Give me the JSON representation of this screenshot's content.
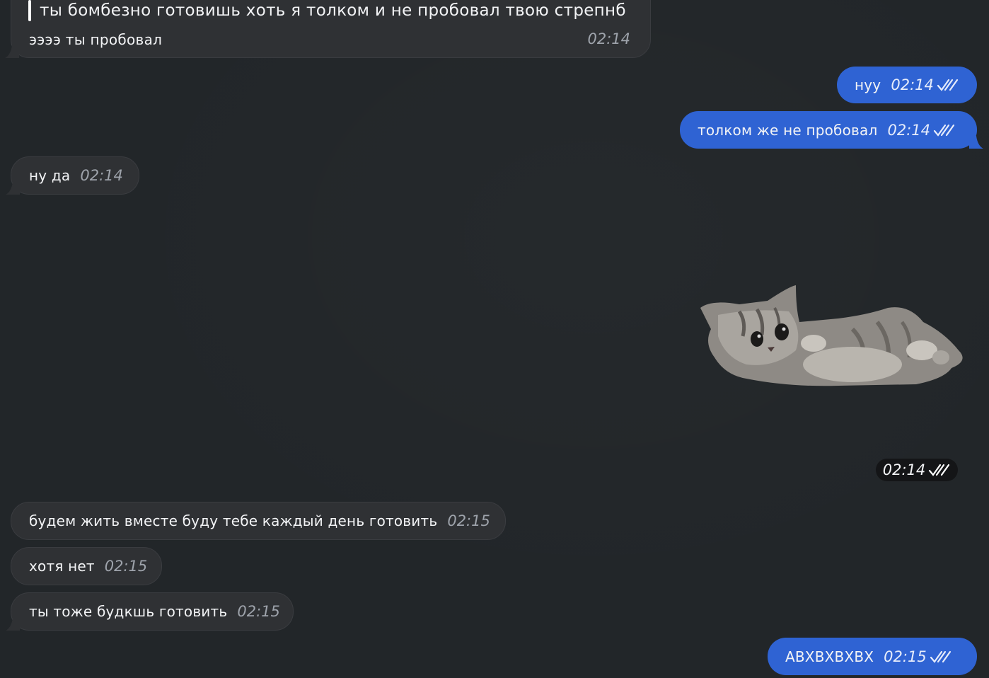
{
  "colors": {
    "background": "#222629",
    "incoming_bubble": "#2f3134",
    "outgoing_bubble": "#2f63d3",
    "time_incoming": "#9ea3ab",
    "time_outgoing": "#e6ecfb",
    "sticker_time_pill": "#141517"
  },
  "reply_message": {
    "quoted_text": "ты бомбезно готовишь хоть я толком и не пробовал твою стрепнб",
    "text": "ээээ ты пробовал",
    "time": "02:14"
  },
  "messages": [
    {
      "direction": "outgoing",
      "text": "нуу",
      "time": "02:14",
      "status_icon": "double-check-icon"
    },
    {
      "direction": "outgoing",
      "text": "толком же не пробовал",
      "time": "02:14",
      "status_icon": "double-check-icon"
    },
    {
      "direction": "incoming",
      "text": "ну да",
      "time": "02:14"
    },
    {
      "direction": "outgoing",
      "type": "sticker",
      "sticker": "kitten-lying-sticker",
      "time": "02:14",
      "status_icon": "double-check-icon"
    },
    {
      "direction": "incoming",
      "text": "будем жить вместе буду тебе каждый день готовить",
      "time": "02:15"
    },
    {
      "direction": "incoming",
      "text": "хотя нет",
      "time": "02:15"
    },
    {
      "direction": "incoming",
      "text": "ты тоже будкшь готовить",
      "time": "02:15"
    },
    {
      "direction": "outgoing",
      "text": "АВХВХВХВХ",
      "time": "02:15",
      "status_icon": "double-check-icon"
    }
  ]
}
